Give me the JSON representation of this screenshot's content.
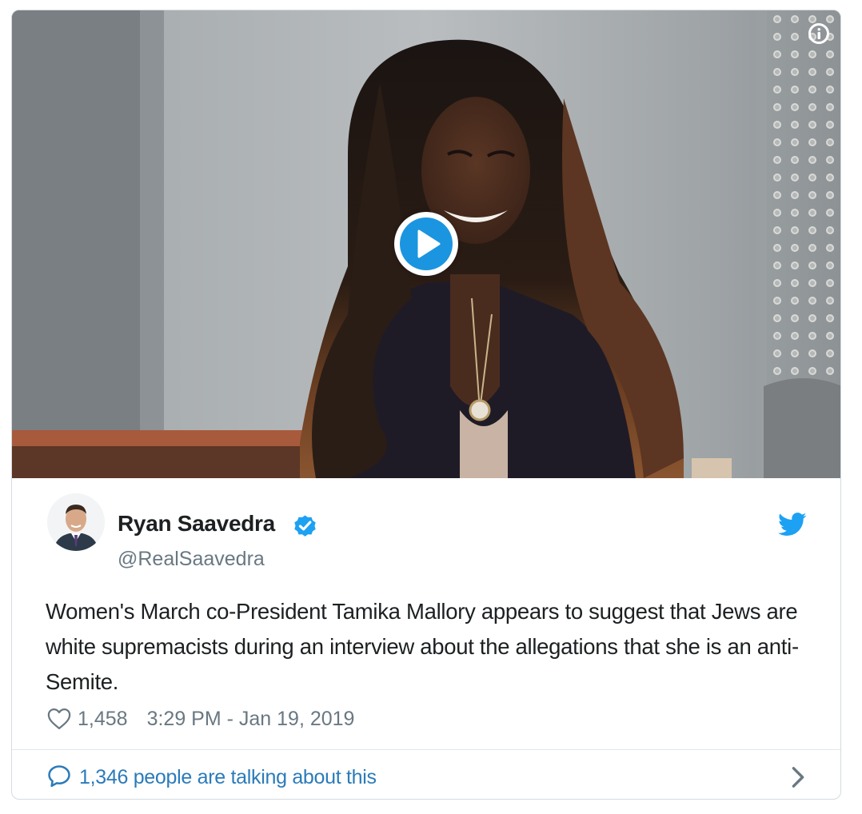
{
  "media": {
    "type": "video",
    "play_label": "Play video",
    "info_label": "Information"
  },
  "author": {
    "name": "Ryan Saavedra",
    "handle": "@RealSaavedra",
    "verified": true
  },
  "tweet": {
    "text": "Women's March co-President Tamika Mallory appears to suggest that Jews are white supremacists during an interview about the allegations that she is an anti-Semite.",
    "likes": "1,458",
    "timestamp": "3:29 PM - Jan 19, 2019"
  },
  "footer": {
    "talking": "1,346 people are talking about this"
  },
  "colors": {
    "link_blue": "#2b7bb9",
    "twitter_blue": "#1da1f2",
    "play_blue": "#1b95e0",
    "muted_gray": "#697882",
    "text": "#1c2022",
    "border": "#d4dbe0"
  },
  "icons": {
    "info": "info-icon",
    "play": "play-icon",
    "verified": "verified-badge-icon",
    "bird": "twitter-bird-icon",
    "heart": "heart-icon",
    "bubble": "speech-bubble-icon",
    "chevron": "chevron-right-icon"
  }
}
